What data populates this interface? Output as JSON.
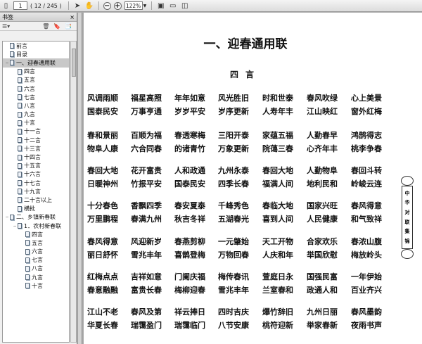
{
  "toolbar": {
    "page_current": "1",
    "page_info": "( 12 / 245 )",
    "zoom_level": "122%",
    "icons": [
      "page-icon",
      "select-arrow-icon",
      "hand-icon",
      "zoom-out-icon",
      "zoom-in-icon",
      "dropdown-arrow-icon",
      "fit-page-icon",
      "fit-width-icon",
      "two-page-icon"
    ]
  },
  "sidebar": {
    "title": "书签",
    "close_glyph": "×",
    "items": [
      {
        "label": "前言",
        "level": 0,
        "twisty": ""
      },
      {
        "label": "目录",
        "level": 0,
        "twisty": ""
      },
      {
        "label": "一、迎春通用联",
        "level": 0,
        "twisty": "−",
        "selected": true
      },
      {
        "label": "四言",
        "level": 1,
        "twisty": ""
      },
      {
        "label": "五言",
        "level": 1,
        "twisty": ""
      },
      {
        "label": "六言",
        "level": 1,
        "twisty": ""
      },
      {
        "label": "七言",
        "level": 1,
        "twisty": ""
      },
      {
        "label": "八言",
        "level": 1,
        "twisty": ""
      },
      {
        "label": "九言",
        "level": 1,
        "twisty": ""
      },
      {
        "label": "十言",
        "level": 1,
        "twisty": ""
      },
      {
        "label": "十一言",
        "level": 1,
        "twisty": ""
      },
      {
        "label": "十二言",
        "level": 1,
        "twisty": ""
      },
      {
        "label": "十三言",
        "level": 1,
        "twisty": ""
      },
      {
        "label": "十四言",
        "level": 1,
        "twisty": ""
      },
      {
        "label": "十五言",
        "level": 1,
        "twisty": ""
      },
      {
        "label": "十六言",
        "level": 1,
        "twisty": ""
      },
      {
        "label": "十七言",
        "level": 1,
        "twisty": ""
      },
      {
        "label": "十九言",
        "level": 1,
        "twisty": ""
      },
      {
        "label": "二十言以上",
        "level": 1,
        "twisty": ""
      },
      {
        "label": "横批",
        "level": 1,
        "twisty": ""
      },
      {
        "label": "二、乡镇新春联",
        "level": 0,
        "twisty": "−"
      },
      {
        "label": "1．农村新春联",
        "level": 1,
        "twisty": "−"
      },
      {
        "label": "四言",
        "level": 2,
        "twisty": ""
      },
      {
        "label": "五言",
        "level": 2,
        "twisty": ""
      },
      {
        "label": "六言",
        "level": 2,
        "twisty": ""
      },
      {
        "label": "七言",
        "level": 2,
        "twisty": ""
      },
      {
        "label": "八言",
        "level": 2,
        "twisty": ""
      },
      {
        "label": "九言",
        "level": 2,
        "twisty": ""
      },
      {
        "label": "十言",
        "level": 2,
        "twisty": ""
      }
    ]
  },
  "document": {
    "title": "一、迎春通用联",
    "subtitle": "四言",
    "couplets": [
      [
        "风调雨顺",
        "福星高照",
        "年年如意",
        "风光胜旧",
        "时和世泰",
        "春风吹绿",
        "心上美景"
      ],
      [
        "国泰民安",
        "万事亨通",
        "岁岁平安",
        "岁序更新",
        "人寿年丰",
        "江山映红",
        "窗外红梅"
      ],
      [
        "春和景丽",
        "百顺为福",
        "春透寒梅",
        "三阳开泰",
        "家蕴五福",
        "人勤春早",
        "鸿鹄得志"
      ],
      [
        "物阜人康",
        "六合同春",
        "的诸青竹",
        "万象更新",
        "院蔼三春",
        "心齐年丰",
        "桃李争春"
      ],
      [
        "春回大地",
        "花开富贵",
        "人和政通",
        "九州永泰",
        "春回大地",
        "人勤物阜",
        "春回斗转"
      ],
      [
        "日暖神州",
        "竹报平安",
        "国泰民安",
        "四季长春",
        "福满人间",
        "地利民和",
        "岭峻云连"
      ],
      [
        "十分春色",
        "香飘四季",
        "春安夏泰",
        "千峰秀色",
        "春临大地",
        "国家兴旺",
        "春风得意"
      ],
      [
        "万里鹏程",
        "春满九州",
        "秋吉冬祥",
        "五湖春光",
        "喜到人间",
        "人民健康",
        "和气致祥"
      ],
      [
        "春风得意",
        "风迎新岁",
        "春燕剪柳",
        "一元肇始",
        "天工开物",
        "合家欢乐",
        "春浓山腹"
      ],
      [
        "丽日舒怀",
        "雪兆丰年",
        "喜鹊登梅",
        "万物回春",
        "人庆和年",
        "举国欣慰",
        "梅放岭头"
      ],
      [
        "红梅点点",
        "吉祥如意",
        "门阑庆福",
        "梅传春讯",
        "萱庭日永",
        "国强民富",
        "一年伊始"
      ],
      [
        "春意融融",
        "富贵长春",
        "梅柳迎春",
        "雪兆丰年",
        "兰室春和",
        "政通人和",
        "百业齐兴"
      ],
      [
        "江山不老",
        "春风及第",
        "祥云捧日",
        "四时吉庆",
        "爆竹辞旧",
        "九州日丽",
        "春风墨韵"
      ],
      [
        "华夏长春",
        "瑞霭盈门",
        "瑞霭临门",
        "八节安康",
        "桃符迎新",
        "举家春新",
        "夜雨书声"
      ]
    ],
    "side_decoration": [
      "中",
      "华",
      "对",
      "联",
      "集",
      "锦"
    ]
  }
}
